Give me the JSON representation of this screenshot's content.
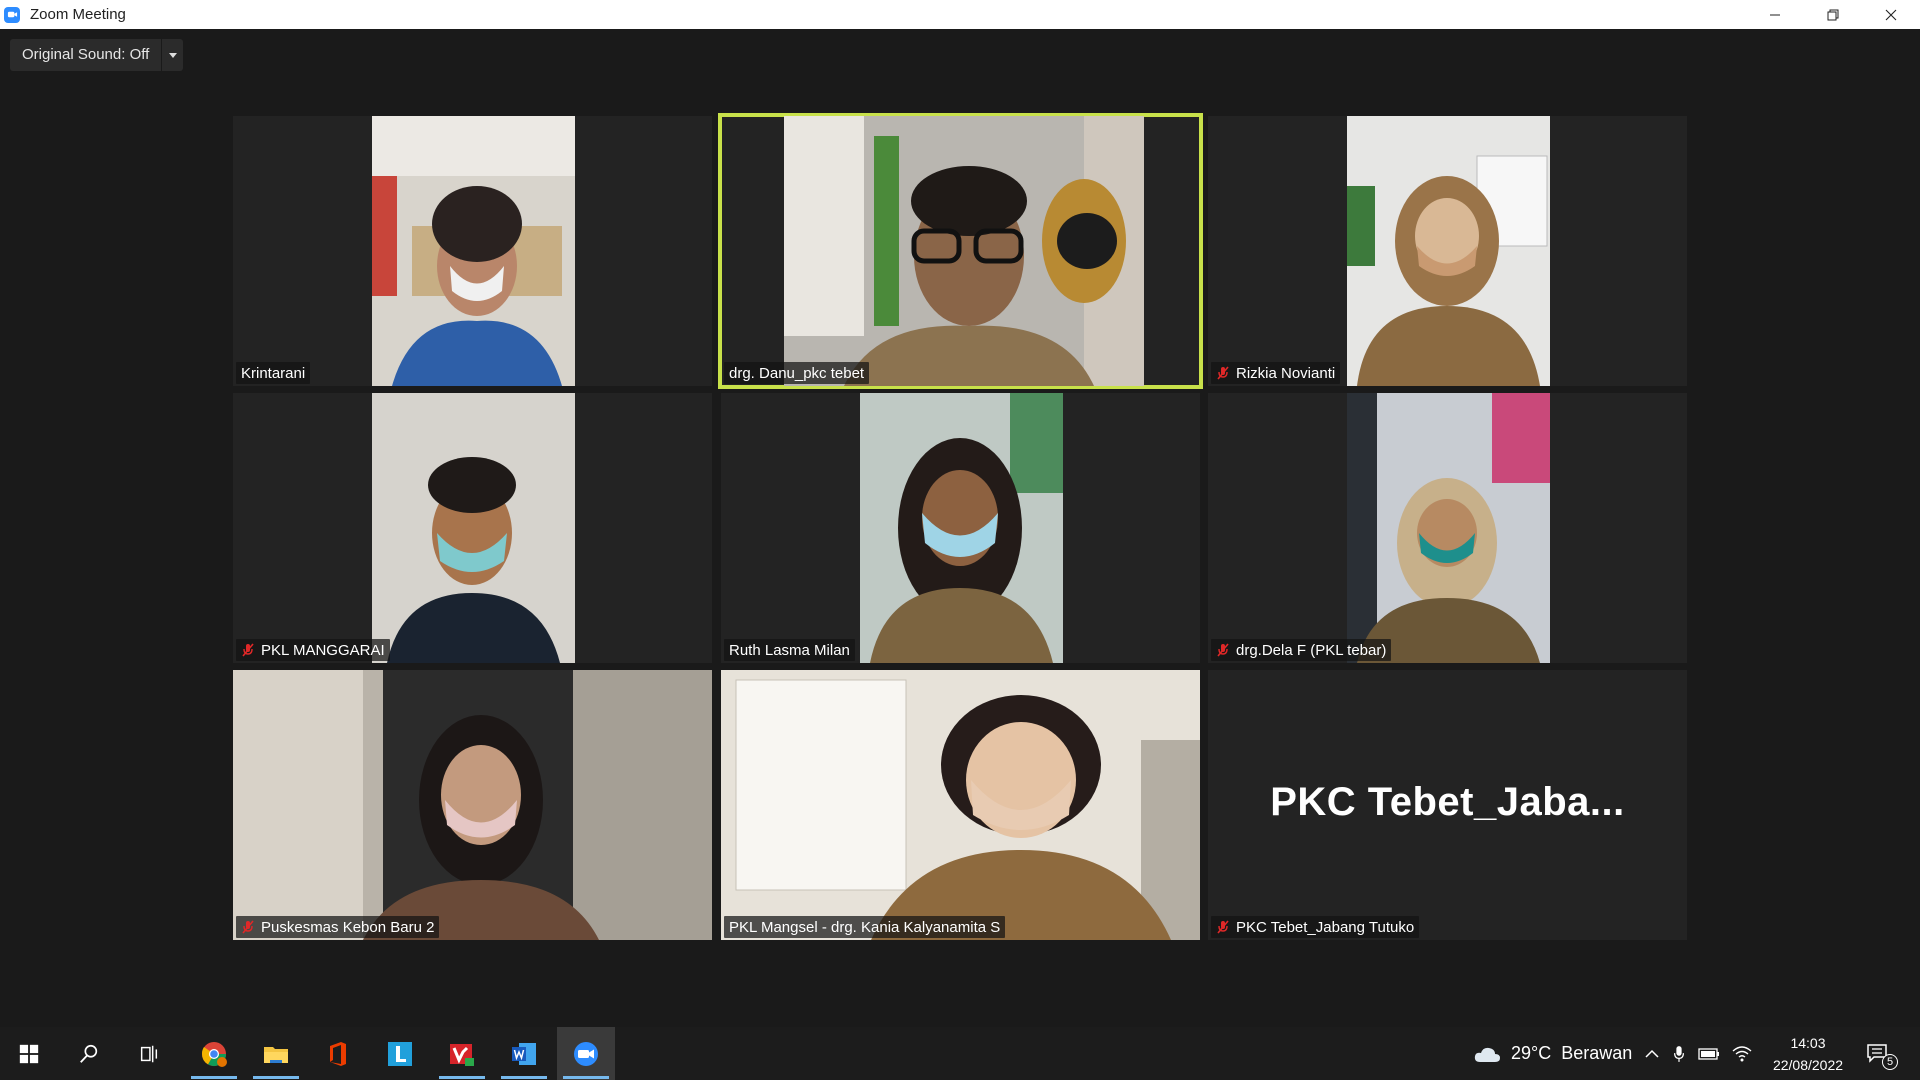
{
  "window": {
    "title": "Zoom Meeting"
  },
  "controls": {
    "original_sound": "Original Sound: Off"
  },
  "participants": [
    {
      "name": "Krintarani",
      "muted": false,
      "active": false
    },
    {
      "name": "drg. Danu_pkc tebet",
      "muted": false,
      "active": true
    },
    {
      "name": "Rizkia Novianti",
      "muted": true,
      "active": false
    },
    {
      "name": "PKL MANGGARAI",
      "muted": true,
      "active": false
    },
    {
      "name": "Ruth Lasma Milan",
      "muted": false,
      "active": false
    },
    {
      "name": "drg.Dela F (PKL tebar)",
      "muted": true,
      "active": false
    },
    {
      "name": "Puskesmas Kebon Baru 2",
      "muted": true,
      "active": false
    },
    {
      "name": "PKL Mangsel - drg. Kania Kalyanamita S",
      "muted": false,
      "active": false
    },
    {
      "name": "PKC Tebet_Jabang Tutuko",
      "muted": true,
      "active": false,
      "display_name": "PKC Tebet_Jaba..."
    }
  ],
  "taskbar": {
    "weather": {
      "temp": "29°C",
      "condition": "Berawan"
    },
    "time": "14:03",
    "date": "22/08/2022",
    "notification_count": "5"
  },
  "colors": {
    "active_speaker": "#c8e14a",
    "zoom_blue": "#2d8cff",
    "mute_red": "#e02828"
  }
}
